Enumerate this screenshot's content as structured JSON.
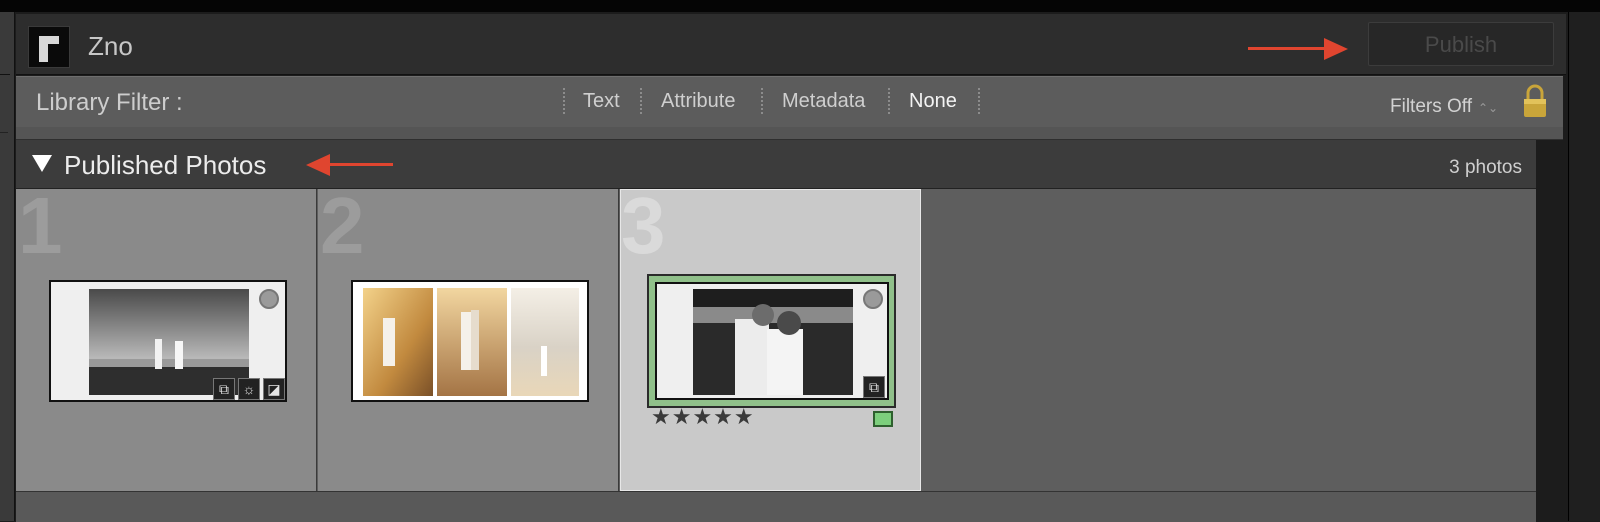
{
  "app": {
    "title": "Zno",
    "publish_label": "Publish"
  },
  "filter_bar": {
    "label": "Library Filter :",
    "tabs": [
      {
        "label": "Text",
        "active": false
      },
      {
        "label": "Attribute",
        "active": false
      },
      {
        "label": "Metadata",
        "active": false
      },
      {
        "label": "None",
        "active": true
      }
    ],
    "filters_state": "Filters Off",
    "filters_arrows": "⌃⌄"
  },
  "section": {
    "title": "Published Photos",
    "count": "3 photos"
  },
  "photos": [
    {
      "index": "1",
      "badges": [
        "crop-icon",
        "develop-icon",
        "exposure-icon"
      ],
      "selected": false
    },
    {
      "index": "2",
      "badges": [],
      "selected": false
    },
    {
      "index": "3",
      "badges": [
        "crop-icon"
      ],
      "selected": true,
      "rating": "★★★★★",
      "color_label": "#7ccf7c"
    }
  ],
  "colors": {
    "annotation_arrow": "#e0452f",
    "selected_border": "#90c08a",
    "selected_cell": "#c9c9c9"
  }
}
